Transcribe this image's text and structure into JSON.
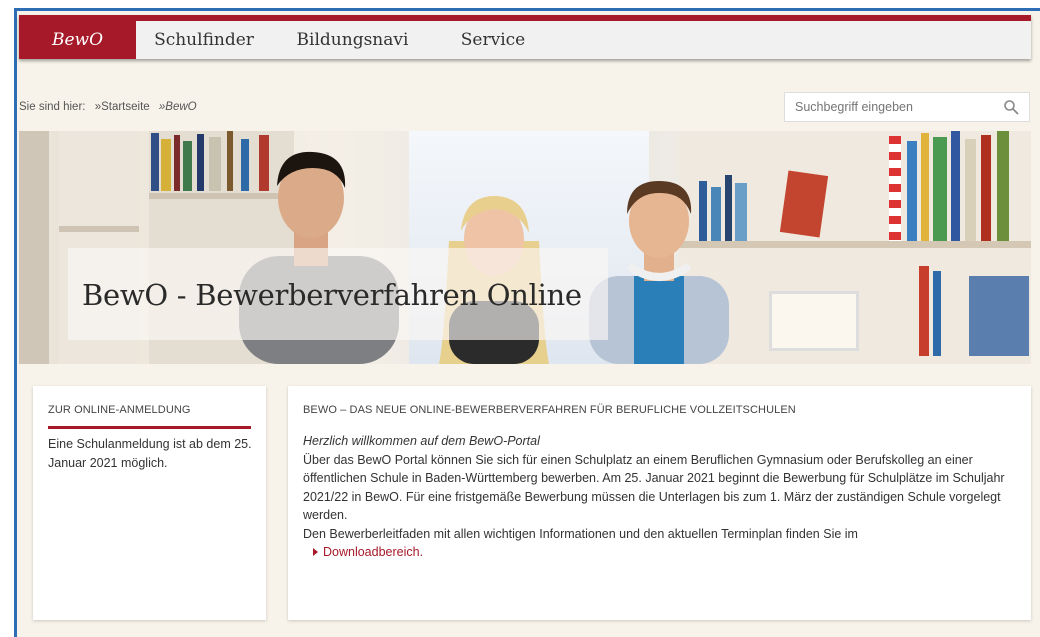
{
  "nav": {
    "items": [
      {
        "label": "BewO"
      },
      {
        "label": "Schulfinder"
      },
      {
        "label": "Bildungsnavi"
      },
      {
        "label": "Service"
      }
    ]
  },
  "breadcrumb": {
    "prefix": "Sie sind hier:",
    "home": "»Startseite",
    "current": "»BewO"
  },
  "search": {
    "placeholder": "Suchbegriff eingeben",
    "icon": "search-icon"
  },
  "hero": {
    "title": "BewO - Bewerberverfahren Online"
  },
  "sidebar_card": {
    "heading": "ZUR ONLINE-ANMELDUNG",
    "text": "Eine Schulanmeldung ist ab dem 25. Januar 2021 möglich."
  },
  "main_card": {
    "heading": "BEWO – DAS NEUE ONLINE-BEWERBERVERFAHREN FÜR BERUFLICHE VOLLZEITSCHULEN",
    "intro": "Herzlich willkommen auf dem BewO-Portal",
    "paragraph": "Über das BewO Portal können Sie sich für einen Schulplatz an einem Beruflichen Gymnasium oder Berufskolleg an einer öffentlichen Schule in Baden-Württemberg bewerben. Am 25. Januar 2021 beginnt die Bewerbung für Schulplätze im Schuljahr 2021/22 in BewO. Für eine fristgemäße Bewerbung müssen die Unterlagen bis zum 1. März der zuständigen Schule vorgelegt werden.",
    "download_text": "Den Bewerberleitfaden mit allen wichtigen Informationen und den aktuellen Terminplan finden Sie im",
    "download_link": "Downloadbereich."
  },
  "colors": {
    "accent": "#a61929",
    "frame": "#2d6db5",
    "background": "#f7f3ea"
  }
}
